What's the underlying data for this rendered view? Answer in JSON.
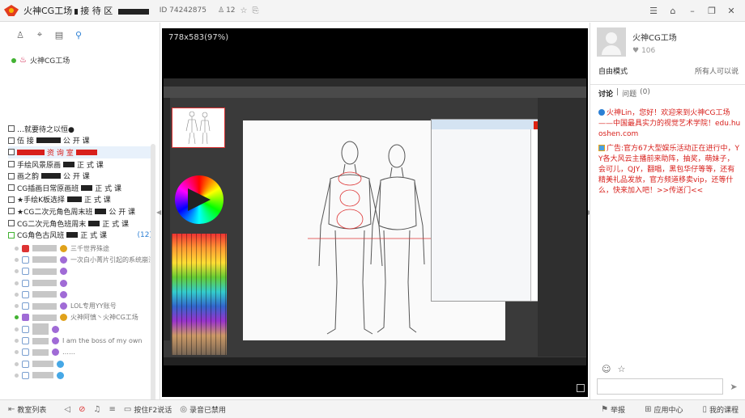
{
  "titlebar": {
    "title": "火神CG工场",
    "subtitle_a": "接 待 区",
    "id_label": "ID 74242875",
    "members": "12",
    "controls": [
      "menu-icon",
      "skin-icon",
      "minimize-icon",
      "restore-icon",
      "close-icon"
    ]
  },
  "left": {
    "root_channel": "火神CG工场",
    "channels": [
      {
        "name": "…就要待之以恒●",
        "count": ""
      },
      {
        "name": "伍 接",
        "name2": "公 开 课",
        "count": ""
      },
      {
        "name": "资 询 室",
        "count": ""
      },
      {
        "name": "手绘风景原画",
        "name2": "正 式 课",
        "count": ""
      },
      {
        "name": "画之韵",
        "name2": "公 开 课",
        "count": ""
      },
      {
        "name": "CG插画日常原画班",
        "name2": "正 式 课",
        "count": ""
      },
      {
        "name": "★手绘K板选择",
        "name2": "正 式 课",
        "count": ""
      },
      {
        "name": "★CG二次元角色周末班",
        "name2": "公 开 课",
        "count": ""
      },
      {
        "name": "CG二次元角色班周末",
        "name2": "正 式 课",
        "count": ""
      },
      {
        "name": "CG角色古风班",
        "name2": "正 式 课",
        "count": "(12)"
      }
    ],
    "users": [
      {
        "text": "三千世界殊途",
        "online": false,
        "badge": "gold"
      },
      {
        "text": "一次白小菁片引起的系统崩溃",
        "online": false,
        "badge": "purple"
      },
      {
        "text": "",
        "online": false,
        "badge": "purple"
      },
      {
        "text": "",
        "online": false,
        "badge": "purple"
      },
      {
        "text": "",
        "online": false,
        "badge": "purple"
      },
      {
        "text": "LOL专用YY账号",
        "online": false,
        "badge": "purple"
      },
      {
        "text": "火神阿慎丶火神CG工场",
        "online": true,
        "badge": "gold"
      },
      {
        "text": "",
        "online": false,
        "badge": "purple"
      },
      {
        "text": "I am the boss of my own",
        "online": false,
        "badge": "purple"
      },
      {
        "text": "……",
        "online": false,
        "badge": "purple"
      },
      {
        "text": "",
        "online": false,
        "badge": "blue"
      },
      {
        "text": "",
        "online": false,
        "badge": "blue"
      }
    ]
  },
  "video": {
    "resolution": "778x583(97%)"
  },
  "right": {
    "host_name": "火神CG工场",
    "likes": "106",
    "mode_label": "自由模式",
    "mode_value": "所有人可以说",
    "tab_discuss": "讨论",
    "tab_question": "问题",
    "question_count": "(0)",
    "message_1": "火神Lin，您好！欢迎来到火神CG工场——中国最具实力的视觉艺术学院！edu.huoshen.com",
    "message_2": "广告:官方67大型娱乐活动正在进行中，YY各大风云主播前来助阵，抽奖，萌妹子，会可儿，QJY，翻唱，黑包华仔等等，还有精美礼品发放，官方频道移卖vip，还等什么，快来加入吧！>>传送门<<"
  },
  "bottombar": {
    "channel_list": "教室列表",
    "f2_talk": "按住F2说话",
    "record": "录音已禁用",
    "report": "举报",
    "app_center": "应用中心",
    "my_cert": "我的课程"
  }
}
